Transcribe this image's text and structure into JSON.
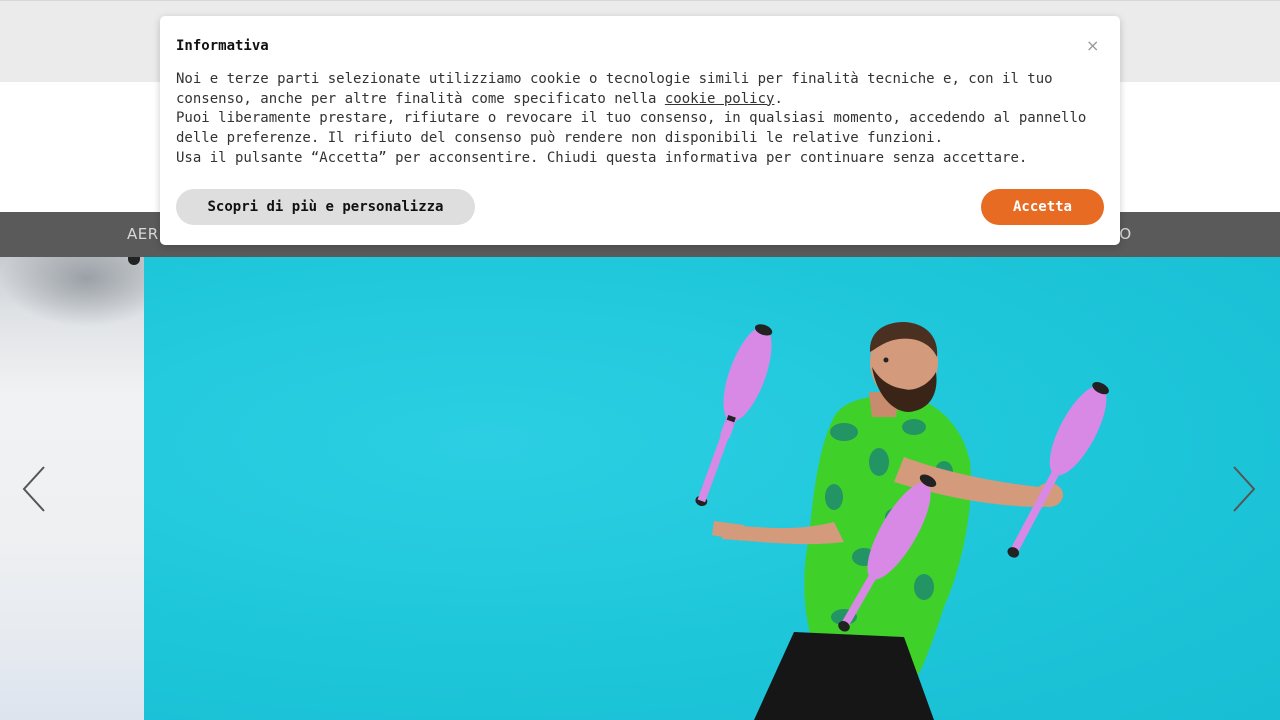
{
  "nav": {
    "left_fragment": "AERI",
    "right_fragment": "NTO"
  },
  "cookie_banner": {
    "title": "Informativa",
    "close_symbol": "×",
    "text_line1_before_link": "Noi e terze parti selezionate utilizziamo cookie o tecnologie simili per finalità tecniche e, con il tuo consenso, anche per altre finalità come specificato nella ",
    "policy_link": "cookie policy",
    "text_line1_after_link": ".",
    "text_line2": "Puoi liberamente prestare, rifiutare o revocare il tuo consenso, in qualsiasi momento, accedendo al pannello delle preferenze. Il rifiuto del consenso può rendere non disponibili le relative funzioni.",
    "text_line3": "Usa il pulsante “Accetta” per acconsentire. Chiudi questa informativa per continuare senza accettare.",
    "customize_button": "Scopri di più e personalizza",
    "accept_button": "Accetta"
  },
  "slider": {
    "prev_icon": "chevron-left-icon",
    "next_icon": "chevron-right-icon"
  },
  "colors": {
    "accent": "#e86b24",
    "navbar": "#5a5a5a",
    "slide_background": "#1ec6da",
    "topbar": "#ebebeb"
  }
}
